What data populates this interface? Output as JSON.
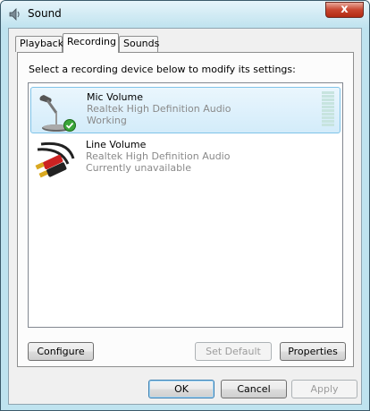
{
  "window": {
    "title": "Sound",
    "close_glyph": "x"
  },
  "tabs": [
    {
      "label": "Playback"
    },
    {
      "label": "Recording"
    },
    {
      "label": "Sounds"
    }
  ],
  "panel": {
    "instructions": "Select a recording device below to modify its settings:",
    "devices": [
      {
        "name": "Mic Volume",
        "driver": "Realtek High Definition Audio",
        "status": "Working",
        "icon": "microphone-icon",
        "default_badge": "green-check-icon",
        "level": 0
      },
      {
        "name": "Line Volume",
        "driver": "Realtek High Definition Audio",
        "status": "Currently unavailable",
        "icon": "rca-cable-icon"
      }
    ],
    "buttons": {
      "configure": "Configure",
      "set_default": "Set Default",
      "properties": "Properties"
    }
  },
  "footer": {
    "ok": "OK",
    "cancel": "Cancel",
    "apply": "Apply"
  },
  "colors": {
    "selection": "#d3ecfa",
    "selection_border": "#7fc3e8",
    "secondary_text": "#8a8a8a",
    "window_frame": "#bfe3ef"
  }
}
